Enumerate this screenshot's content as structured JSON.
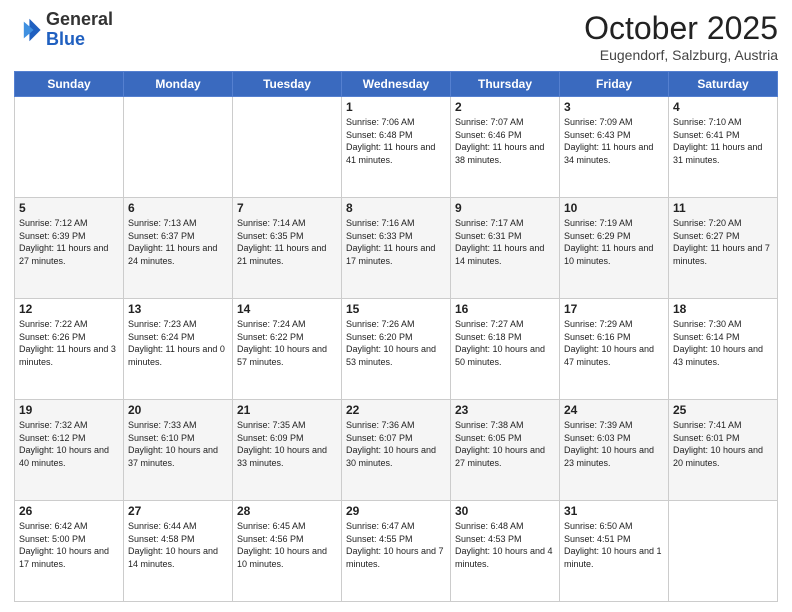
{
  "header": {
    "logo_general": "General",
    "logo_blue": "Blue",
    "month": "October 2025",
    "location": "Eugendorf, Salzburg, Austria"
  },
  "days_of_week": [
    "Sunday",
    "Monday",
    "Tuesday",
    "Wednesday",
    "Thursday",
    "Friday",
    "Saturday"
  ],
  "weeks": [
    [
      {
        "day": "",
        "info": ""
      },
      {
        "day": "",
        "info": ""
      },
      {
        "day": "",
        "info": ""
      },
      {
        "day": "1",
        "info": "Sunrise: 7:06 AM\nSunset: 6:48 PM\nDaylight: 11 hours\nand 41 minutes."
      },
      {
        "day": "2",
        "info": "Sunrise: 7:07 AM\nSunset: 6:46 PM\nDaylight: 11 hours\nand 38 minutes."
      },
      {
        "day": "3",
        "info": "Sunrise: 7:09 AM\nSunset: 6:43 PM\nDaylight: 11 hours\nand 34 minutes."
      },
      {
        "day": "4",
        "info": "Sunrise: 7:10 AM\nSunset: 6:41 PM\nDaylight: 11 hours\nand 31 minutes."
      }
    ],
    [
      {
        "day": "5",
        "info": "Sunrise: 7:12 AM\nSunset: 6:39 PM\nDaylight: 11 hours\nand 27 minutes."
      },
      {
        "day": "6",
        "info": "Sunrise: 7:13 AM\nSunset: 6:37 PM\nDaylight: 11 hours\nand 24 minutes."
      },
      {
        "day": "7",
        "info": "Sunrise: 7:14 AM\nSunset: 6:35 PM\nDaylight: 11 hours\nand 21 minutes."
      },
      {
        "day": "8",
        "info": "Sunrise: 7:16 AM\nSunset: 6:33 PM\nDaylight: 11 hours\nand 17 minutes."
      },
      {
        "day": "9",
        "info": "Sunrise: 7:17 AM\nSunset: 6:31 PM\nDaylight: 11 hours\nand 14 minutes."
      },
      {
        "day": "10",
        "info": "Sunrise: 7:19 AM\nSunset: 6:29 PM\nDaylight: 11 hours\nand 10 minutes."
      },
      {
        "day": "11",
        "info": "Sunrise: 7:20 AM\nSunset: 6:27 PM\nDaylight: 11 hours\nand 7 minutes."
      }
    ],
    [
      {
        "day": "12",
        "info": "Sunrise: 7:22 AM\nSunset: 6:26 PM\nDaylight: 11 hours\nand 3 minutes."
      },
      {
        "day": "13",
        "info": "Sunrise: 7:23 AM\nSunset: 6:24 PM\nDaylight: 11 hours\nand 0 minutes."
      },
      {
        "day": "14",
        "info": "Sunrise: 7:24 AM\nSunset: 6:22 PM\nDaylight: 10 hours\nand 57 minutes."
      },
      {
        "day": "15",
        "info": "Sunrise: 7:26 AM\nSunset: 6:20 PM\nDaylight: 10 hours\nand 53 minutes."
      },
      {
        "day": "16",
        "info": "Sunrise: 7:27 AM\nSunset: 6:18 PM\nDaylight: 10 hours\nand 50 minutes."
      },
      {
        "day": "17",
        "info": "Sunrise: 7:29 AM\nSunset: 6:16 PM\nDaylight: 10 hours\nand 47 minutes."
      },
      {
        "day": "18",
        "info": "Sunrise: 7:30 AM\nSunset: 6:14 PM\nDaylight: 10 hours\nand 43 minutes."
      }
    ],
    [
      {
        "day": "19",
        "info": "Sunrise: 7:32 AM\nSunset: 6:12 PM\nDaylight: 10 hours\nand 40 minutes."
      },
      {
        "day": "20",
        "info": "Sunrise: 7:33 AM\nSunset: 6:10 PM\nDaylight: 10 hours\nand 37 minutes."
      },
      {
        "day": "21",
        "info": "Sunrise: 7:35 AM\nSunset: 6:09 PM\nDaylight: 10 hours\nand 33 minutes."
      },
      {
        "day": "22",
        "info": "Sunrise: 7:36 AM\nSunset: 6:07 PM\nDaylight: 10 hours\nand 30 minutes."
      },
      {
        "day": "23",
        "info": "Sunrise: 7:38 AM\nSunset: 6:05 PM\nDaylight: 10 hours\nand 27 minutes."
      },
      {
        "day": "24",
        "info": "Sunrise: 7:39 AM\nSunset: 6:03 PM\nDaylight: 10 hours\nand 23 minutes."
      },
      {
        "day": "25",
        "info": "Sunrise: 7:41 AM\nSunset: 6:01 PM\nDaylight: 10 hours\nand 20 minutes."
      }
    ],
    [
      {
        "day": "26",
        "info": "Sunrise: 6:42 AM\nSunset: 5:00 PM\nDaylight: 10 hours\nand 17 minutes."
      },
      {
        "day": "27",
        "info": "Sunrise: 6:44 AM\nSunset: 4:58 PM\nDaylight: 10 hours\nand 14 minutes."
      },
      {
        "day": "28",
        "info": "Sunrise: 6:45 AM\nSunset: 4:56 PM\nDaylight: 10 hours\nand 10 minutes."
      },
      {
        "day": "29",
        "info": "Sunrise: 6:47 AM\nSunset: 4:55 PM\nDaylight: 10 hours\nand 7 minutes."
      },
      {
        "day": "30",
        "info": "Sunrise: 6:48 AM\nSunset: 4:53 PM\nDaylight: 10 hours\nand 4 minutes."
      },
      {
        "day": "31",
        "info": "Sunrise: 6:50 AM\nSunset: 4:51 PM\nDaylight: 10 hours\nand 1 minute."
      },
      {
        "day": "",
        "info": ""
      }
    ]
  ]
}
